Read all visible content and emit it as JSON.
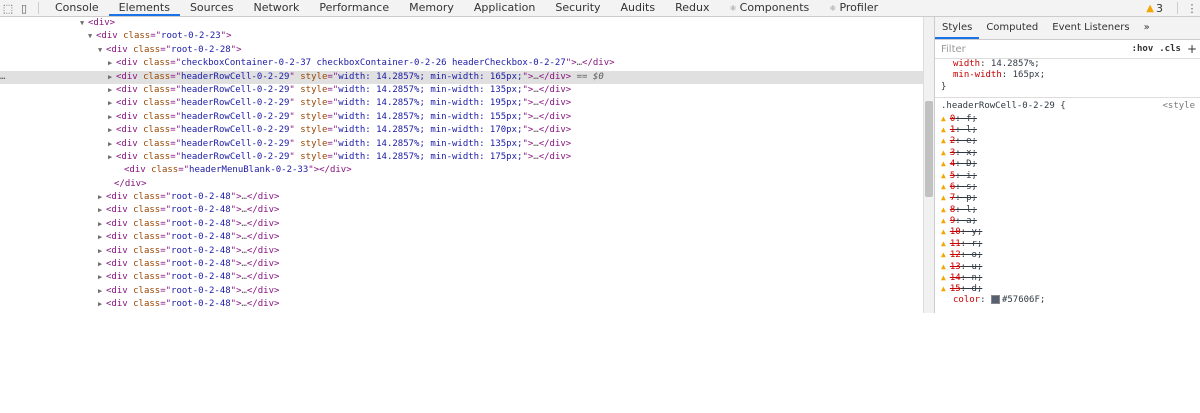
{
  "topbar": {
    "tabs": [
      {
        "label": "Console",
        "active": false
      },
      {
        "label": "Elements",
        "active": true
      },
      {
        "label": "Sources",
        "active": false
      },
      {
        "label": "Network",
        "active": false
      },
      {
        "label": "Performance",
        "active": false
      },
      {
        "label": "Memory",
        "active": false
      },
      {
        "label": "Application",
        "active": false
      },
      {
        "label": "Security",
        "active": false
      },
      {
        "label": "Audits",
        "active": false
      },
      {
        "label": "Redux",
        "active": false
      },
      {
        "label": "Components",
        "active": false,
        "dot": true
      },
      {
        "label": "Profiler",
        "active": false,
        "dot": true
      }
    ],
    "warning_count": "3"
  },
  "dom": {
    "selected_suffix": "== $0",
    "lines": [
      {
        "indent": 80,
        "tri": "open",
        "html": "<div>"
      },
      {
        "indent": 88,
        "tri": "open",
        "tag": "div",
        "attrs": [
          [
            "class",
            "root-0-2-23"
          ]
        ],
        "close": ">"
      },
      {
        "indent": 98,
        "tri": "open",
        "tag": "div",
        "attrs": [
          [
            "class",
            "root-0-2-28"
          ]
        ],
        "close": ">"
      },
      {
        "indent": 108,
        "tri": "closed",
        "tag": "div",
        "attrs": [
          [
            "class",
            "checkboxContainer-0-2-37 checkboxContainer-0-2-26 headerCheckbox-0-2-27"
          ]
        ],
        "close": ">…</div>"
      },
      {
        "indent": 108,
        "tri": "closed",
        "tag": "div",
        "attrs": [
          [
            "class",
            "headerRowCell-0-2-29"
          ],
          [
            "style",
            "width: 14.2857%; min-width: 165px;"
          ]
        ],
        "close": ">…</div>",
        "selected": true
      },
      {
        "indent": 108,
        "tri": "closed",
        "tag": "div",
        "attrs": [
          [
            "class",
            "headerRowCell-0-2-29"
          ],
          [
            "style",
            "width: 14.2857%; min-width: 135px;"
          ]
        ],
        "close": ">…</div>"
      },
      {
        "indent": 108,
        "tri": "closed",
        "tag": "div",
        "attrs": [
          [
            "class",
            "headerRowCell-0-2-29"
          ],
          [
            "style",
            "width: 14.2857%; min-width: 195px;"
          ]
        ],
        "close": ">…</div>"
      },
      {
        "indent": 108,
        "tri": "closed",
        "tag": "div",
        "attrs": [
          [
            "class",
            "headerRowCell-0-2-29"
          ],
          [
            "style",
            "width: 14.2857%; min-width: 155px;"
          ]
        ],
        "close": ">…</div>"
      },
      {
        "indent": 108,
        "tri": "closed",
        "tag": "div",
        "attrs": [
          [
            "class",
            "headerRowCell-0-2-29"
          ],
          [
            "style",
            "width: 14.2857%; min-width: 170px;"
          ]
        ],
        "close": ">…</div>"
      },
      {
        "indent": 108,
        "tri": "closed",
        "tag": "div",
        "attrs": [
          [
            "class",
            "headerRowCell-0-2-29"
          ],
          [
            "style",
            "width: 14.2857%; min-width: 135px;"
          ]
        ],
        "close": ">…</div>"
      },
      {
        "indent": 108,
        "tri": "closed",
        "tag": "div",
        "attrs": [
          [
            "class",
            "headerRowCell-0-2-29"
          ],
          [
            "style",
            "width: 14.2857%; min-width: 175px;"
          ]
        ],
        "close": ">…</div>"
      },
      {
        "indent": 116,
        "tri": "none",
        "tag": "div",
        "attrs": [
          [
            "class",
            "headerMenuBlank-0-2-33"
          ]
        ],
        "close": "></div>"
      },
      {
        "indent": 106,
        "tri": "none",
        "html": "</div>"
      },
      {
        "indent": 98,
        "tri": "closed",
        "tag": "div",
        "attrs": [
          [
            "class",
            "root-0-2-48"
          ]
        ],
        "close": ">…</div>"
      },
      {
        "indent": 98,
        "tri": "closed",
        "tag": "div",
        "attrs": [
          [
            "class",
            "root-0-2-48"
          ]
        ],
        "close": ">…</div>"
      },
      {
        "indent": 98,
        "tri": "closed",
        "tag": "div",
        "attrs": [
          [
            "class",
            "root-0-2-48"
          ]
        ],
        "close": ">…</div>"
      },
      {
        "indent": 98,
        "tri": "closed",
        "tag": "div",
        "attrs": [
          [
            "class",
            "root-0-2-48"
          ]
        ],
        "close": ">…</div>"
      },
      {
        "indent": 98,
        "tri": "closed",
        "tag": "div",
        "attrs": [
          [
            "class",
            "root-0-2-48"
          ]
        ],
        "close": ">…</div>"
      },
      {
        "indent": 98,
        "tri": "closed",
        "tag": "div",
        "attrs": [
          [
            "class",
            "root-0-2-48"
          ]
        ],
        "close": ">…</div>"
      },
      {
        "indent": 98,
        "tri": "closed",
        "tag": "div",
        "attrs": [
          [
            "class",
            "root-0-2-48"
          ]
        ],
        "close": ">…</div>"
      },
      {
        "indent": 98,
        "tri": "closed",
        "tag": "div",
        "attrs": [
          [
            "class",
            "root-0-2-48"
          ]
        ],
        "close": ">…</div>"
      },
      {
        "indent": 98,
        "tri": "closed",
        "tag": "div",
        "attrs": [
          [
            "class",
            "root-0-2-48"
          ]
        ],
        "close": ">…</div>"
      }
    ]
  },
  "styles": {
    "tabs": [
      "Styles",
      "Computed",
      "Event Listeners",
      "»"
    ],
    "filter_placeholder": "Filter",
    "hov_label": ":hov",
    "cls_label": ".cls",
    "plus_label": "+",
    "element_style_lines": [
      "width: 14.2857%;",
      "min-width: 165px;",
      "}"
    ],
    "rule_selector": ".headerRowCell-0-2-29 {",
    "rule_source": "<style",
    "invalid_props": [
      "0: f;",
      "1: l;",
      "2: e;",
      "3: x;",
      "4: D;",
      "5: i;",
      "6: s;",
      "7: p;",
      "8: l;",
      "9: a;",
      "10: y;",
      "11: r;",
      "12: o;",
      "13: u;",
      "14: n;",
      "15: d;"
    ],
    "color_prop": "color",
    "color_value": "#57606F",
    "color_hex": "#57606f"
  }
}
